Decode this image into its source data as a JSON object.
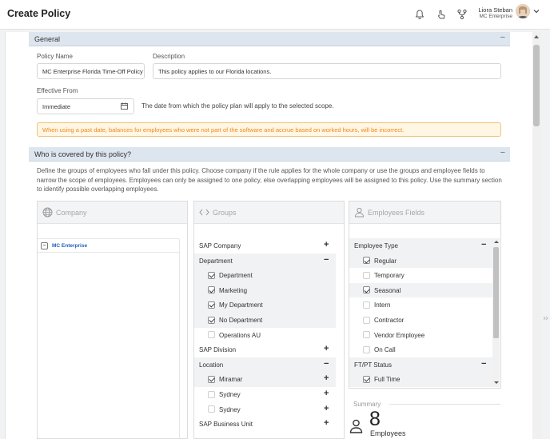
{
  "page_title": "Create Policy",
  "user": {
    "name": "Liora Steban",
    "org": "MC Enterprise"
  },
  "general": {
    "section_title": "General",
    "policy_name_label": "Policy Name",
    "policy_name_value": "MC Enterprise Florida Time-Off Policy",
    "description_label": "Description",
    "description_value": "This policy applies to our Florida locations.",
    "effective_from_label": "Effective From",
    "effective_from_value": "Immediate",
    "effective_hint": "The date from which the policy plan will apply to the selected scope.",
    "warning": "When using a past date, balances for employees who were not part of the software and accrue based on worked hours, will be incorrect."
  },
  "coverage": {
    "section_title": "Who is covered by this policy?",
    "description": "Define the groups of employees who fall under this policy. Choose company if the rule applies for the whole company or use the groups and employee fields to narrow the scope of employees. Employees can only be assigned to one policy, else overlapping employees will be assigned to this policy. Use the summary section to identify possible overlapping employees."
  },
  "company_panel": {
    "title": "Company",
    "items": [
      {
        "label": "MC Enterprise",
        "toggle": "−"
      }
    ]
  },
  "groups_panel": {
    "title": "Groups",
    "rows": [
      {
        "label": "SAP Company",
        "kind": "header",
        "toggle": "+"
      },
      {
        "label": "Department",
        "kind": "header",
        "toggle": "−"
      },
      {
        "label": "Department",
        "kind": "child",
        "checked": true
      },
      {
        "label": "Marketing",
        "kind": "child",
        "checked": true
      },
      {
        "label": "My Department",
        "kind": "child",
        "checked": true
      },
      {
        "label": "No Department",
        "kind": "child",
        "checked": true
      },
      {
        "label": "Operations AU",
        "kind": "child",
        "checked": false
      },
      {
        "label": "SAP Division",
        "kind": "header",
        "toggle": "+"
      },
      {
        "label": "Location",
        "kind": "header",
        "toggle": "−"
      },
      {
        "label": "Miramar",
        "kind": "child",
        "checked": true,
        "toggle": "+"
      },
      {
        "label": "Sydney",
        "kind": "child",
        "checked": false,
        "toggle": "+"
      },
      {
        "label": "Sydney",
        "kind": "child",
        "checked": false,
        "toggle": "+"
      },
      {
        "label": "SAP Business Unit",
        "kind": "header",
        "toggle": "+"
      }
    ]
  },
  "fields_panel": {
    "title": "Employees Fields",
    "rows": [
      {
        "label": "Employee Type",
        "kind": "header",
        "toggle": "−"
      },
      {
        "label": "Regular",
        "kind": "child",
        "checked": true
      },
      {
        "label": "Temporary",
        "kind": "child",
        "checked": false
      },
      {
        "label": "Seasonal",
        "kind": "child",
        "checked": true
      },
      {
        "label": "Intern",
        "kind": "child",
        "checked": false
      },
      {
        "label": "Contractor",
        "kind": "child",
        "checked": false
      },
      {
        "label": "Vendor Employee",
        "kind": "child",
        "checked": false
      },
      {
        "label": "On Call",
        "kind": "child",
        "checked": false
      },
      {
        "label": "FT/PT Status",
        "kind": "header",
        "toggle": "−"
      },
      {
        "label": "Full Time",
        "kind": "child",
        "checked": true
      }
    ]
  },
  "summary": {
    "label": "Summary",
    "count": "8",
    "unit": "Employees"
  },
  "colors": {
    "section_header": "#dde5ee",
    "warning_text": "#ec8a1e",
    "link_blue": "#1f5fbf"
  }
}
